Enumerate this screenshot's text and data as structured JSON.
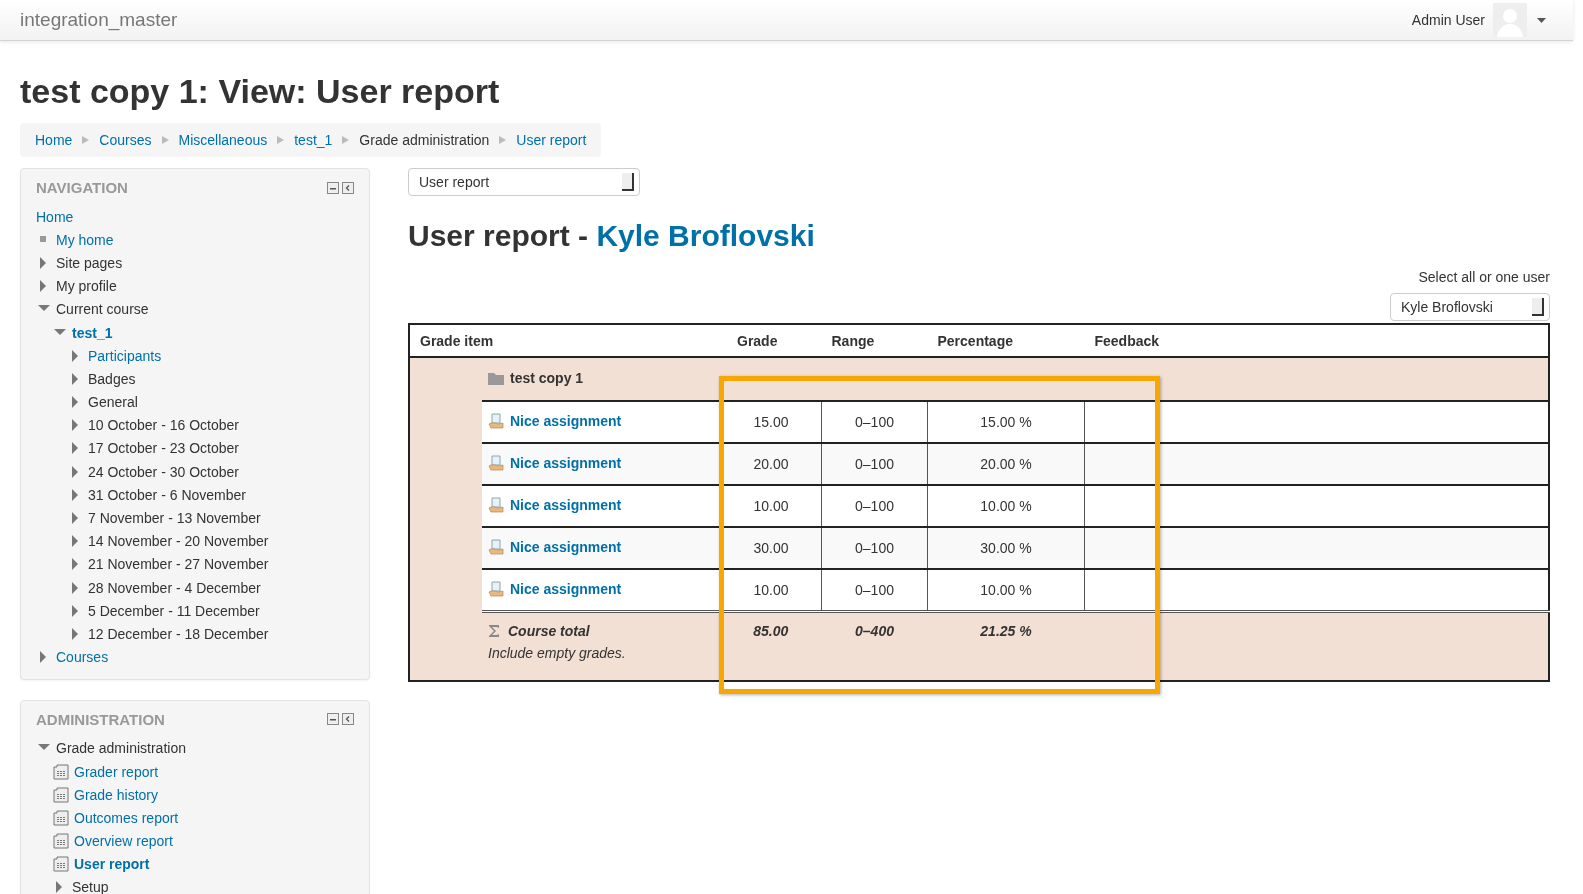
{
  "navbar": {
    "site_name": "integration_master",
    "user_name": "Admin User"
  },
  "page_title": "test copy 1: View: User report",
  "breadcrumb": [
    {
      "label": "Home",
      "link": true
    },
    {
      "label": "Courses",
      "link": true
    },
    {
      "label": "Miscellaneous",
      "link": true
    },
    {
      "label": "test_1",
      "link": true
    },
    {
      "label": "Grade administration",
      "link": false
    },
    {
      "label": "User report",
      "link": true
    }
  ],
  "blocks": [
    {
      "title": "NAVIGATION",
      "items": [
        {
          "label": "Home",
          "kind": "root",
          "link": true,
          "current": false
        },
        {
          "label": "My home",
          "kind": "leaf",
          "link": true,
          "current": false
        },
        {
          "label": "Site pages",
          "kind": "branch",
          "link": false,
          "current": false,
          "expanded": false
        },
        {
          "label": "My profile",
          "kind": "branch",
          "link": false,
          "current": false,
          "expanded": false
        },
        {
          "label": "Current course",
          "kind": "branch",
          "link": false,
          "current": false,
          "expanded": true,
          "children": [
            {
              "label": "test_1",
              "kind": "branch",
              "link": true,
              "current": true,
              "expanded": true,
              "children": [
                {
                  "label": "Participants",
                  "kind": "branch",
                  "link": true,
                  "current": false,
                  "expanded": false
                },
                {
                  "label": "Badges",
                  "kind": "branch",
                  "link": false,
                  "current": false,
                  "expanded": false
                },
                {
                  "label": "General",
                  "kind": "branch",
                  "link": false,
                  "current": false,
                  "expanded": false
                },
                {
                  "label": "10 October - 16 October",
                  "kind": "branch",
                  "link": false,
                  "current": false,
                  "expanded": false
                },
                {
                  "label": "17 October - 23 October",
                  "kind": "branch",
                  "link": false,
                  "current": false,
                  "expanded": false
                },
                {
                  "label": "24 October - 30 October",
                  "kind": "branch",
                  "link": false,
                  "current": false,
                  "expanded": false
                },
                {
                  "label": "31 October - 6 November",
                  "kind": "branch",
                  "link": false,
                  "current": false,
                  "expanded": false
                },
                {
                  "label": "7 November - 13 November",
                  "kind": "branch",
                  "link": false,
                  "current": false,
                  "expanded": false
                },
                {
                  "label": "14 November - 20 November",
                  "kind": "branch",
                  "link": false,
                  "current": false,
                  "expanded": false
                },
                {
                  "label": "21 November - 27 November",
                  "kind": "branch",
                  "link": false,
                  "current": false,
                  "expanded": false
                },
                {
                  "label": "28 November - 4 December",
                  "kind": "branch",
                  "link": false,
                  "current": false,
                  "expanded": false
                },
                {
                  "label": "5 December - 11 December",
                  "kind": "branch",
                  "link": false,
                  "current": false,
                  "expanded": false
                },
                {
                  "label": "12 December - 18 December",
                  "kind": "branch",
                  "link": false,
                  "current": false,
                  "expanded": false
                }
              ]
            }
          ]
        },
        {
          "label": "Courses",
          "kind": "branch",
          "link": true,
          "current": false,
          "expanded": false
        }
      ]
    },
    {
      "title": "ADMINISTRATION",
      "items": [
        {
          "label": "Grade administration",
          "kind": "branch",
          "link": false,
          "current": false,
          "expanded": true,
          "children": [
            {
              "label": "Grader report",
              "kind": "report",
              "link": true,
              "current": false
            },
            {
              "label": "Grade history",
              "kind": "report",
              "link": true,
              "current": false
            },
            {
              "label": "Outcomes report",
              "kind": "report",
              "link": true,
              "current": false
            },
            {
              "label": "Overview report",
              "kind": "report",
              "link": true,
              "current": false
            },
            {
              "label": "User report",
              "kind": "report",
              "link": true,
              "current": true
            },
            {
              "label": "Setup",
              "kind": "branch",
              "link": false,
              "current": false,
              "expanded": false
            }
          ]
        }
      ]
    }
  ],
  "report_select": {
    "value": "User report"
  },
  "report_heading": {
    "prefix": "User report - ",
    "user": "Kyle Broflovski"
  },
  "user_select": {
    "label": "Select all or one user",
    "value": "Kyle Broflovski"
  },
  "table": {
    "columns": [
      "Grade item",
      "Grade",
      "Range",
      "Percentage",
      "Feedback"
    ],
    "category": "test copy 1",
    "rows": [
      {
        "item": "Nice assignment",
        "grade": "15.00",
        "range": "0–100",
        "percentage": "15.00 %",
        "feedback": ""
      },
      {
        "item": "Nice assignment",
        "grade": "20.00",
        "range": "0–100",
        "percentage": "20.00 %",
        "feedback": ""
      },
      {
        "item": "Nice assignment",
        "grade": "10.00",
        "range": "0–100",
        "percentage": "10.00 %",
        "feedback": ""
      },
      {
        "item": "Nice assignment",
        "grade": "30.00",
        "range": "0–100",
        "percentage": "30.00 %",
        "feedback": ""
      },
      {
        "item": "Nice assignment",
        "grade": "10.00",
        "range": "0–100",
        "percentage": "10.00 %",
        "feedback": ""
      }
    ],
    "total": {
      "item": "Course total",
      "note": "Include empty grades.",
      "grade": "85.00",
      "range": "0–400",
      "percentage": "21.25 %"
    }
  }
}
